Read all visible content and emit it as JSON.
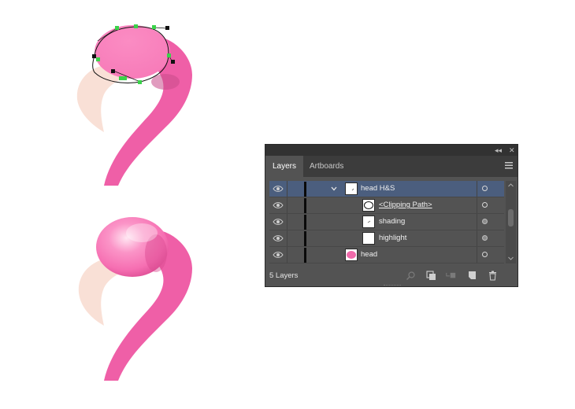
{
  "artwork": {
    "colors": {
      "neck": "#ef5fa7",
      "head": "#f97cbb",
      "head_highlight": "#fff2f8",
      "head_shade": "#d94a90",
      "beak": "#f9e0d6",
      "path_stroke": "#111111",
      "anchor_selected": "#3ad34a",
      "anchor": "#111111"
    }
  },
  "layers_panel": {
    "title_buttons": [
      "collapse-icon",
      "close-icon"
    ],
    "tabs": [
      {
        "label": "Layers",
        "active": true
      },
      {
        "label": "Artboards",
        "active": false
      }
    ],
    "rows": [
      {
        "name": "head H&S",
        "indent": 1,
        "expanded": true,
        "selected": true,
        "target_filled": false
      },
      {
        "name": "<Clipping Path>",
        "indent": 2,
        "selected": false,
        "target_filled": false,
        "underlined": true
      },
      {
        "name": "shading",
        "indent": 2,
        "selected": false,
        "target_filled": true
      },
      {
        "name": "highlight",
        "indent": 2,
        "selected": false,
        "target_filled": true
      },
      {
        "name": "head",
        "indent": 1,
        "selected": false,
        "target_filled": false
      }
    ],
    "footer": {
      "layer_count": "5 Layers",
      "icons": [
        "locate-object-icon",
        "make-clipping-mask-icon",
        "new-sublayer-icon",
        "new-layer-icon",
        "trash-icon"
      ]
    },
    "colors": {
      "panel_bg": "#535353",
      "selected_row": "#4b5e7e",
      "head_thumb": "#f06aaa"
    }
  }
}
